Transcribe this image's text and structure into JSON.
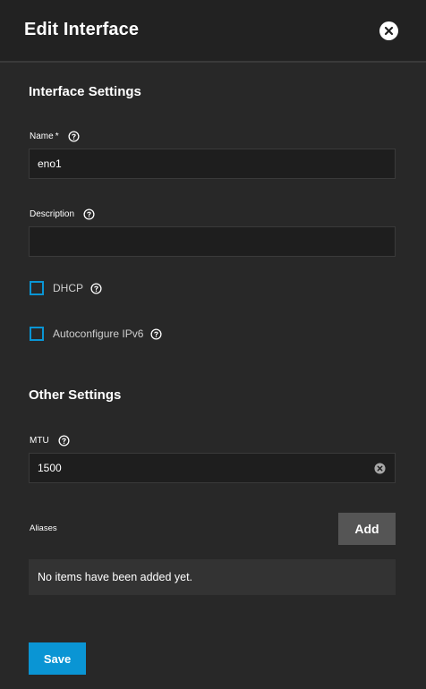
{
  "header": {
    "title": "Edit Interface",
    "close_icon": "close-icon"
  },
  "interface_settings": {
    "title": "Interface Settings",
    "name": {
      "label": "Name",
      "required_marker": "*",
      "value": "eno1",
      "help_icon": "help-circle-icon"
    },
    "description": {
      "label": "Description",
      "value": "",
      "help_icon": "help-circle-icon"
    },
    "dhcp": {
      "label": "DHCP",
      "checked": false,
      "help_icon": "help-circle-icon"
    },
    "autoconfigure_ipv6": {
      "label": "Autoconfigure IPv6",
      "checked": false,
      "help_icon": "help-circle-icon"
    }
  },
  "other_settings": {
    "title": "Other Settings",
    "mtu": {
      "label": "MTU",
      "value": "1500",
      "help_icon": "help-circle-icon",
      "clear_icon": "clear-circle-icon"
    },
    "aliases": {
      "label": "Aliases",
      "add_label": "Add",
      "empty_text": "No items have been added yet."
    }
  },
  "footer": {
    "save_label": "Save"
  },
  "colors": {
    "background": "#282828",
    "header_background": "#222222",
    "input_background": "#1e1e1e",
    "accent": "#0a95d4",
    "secondary_button": "#555555"
  }
}
